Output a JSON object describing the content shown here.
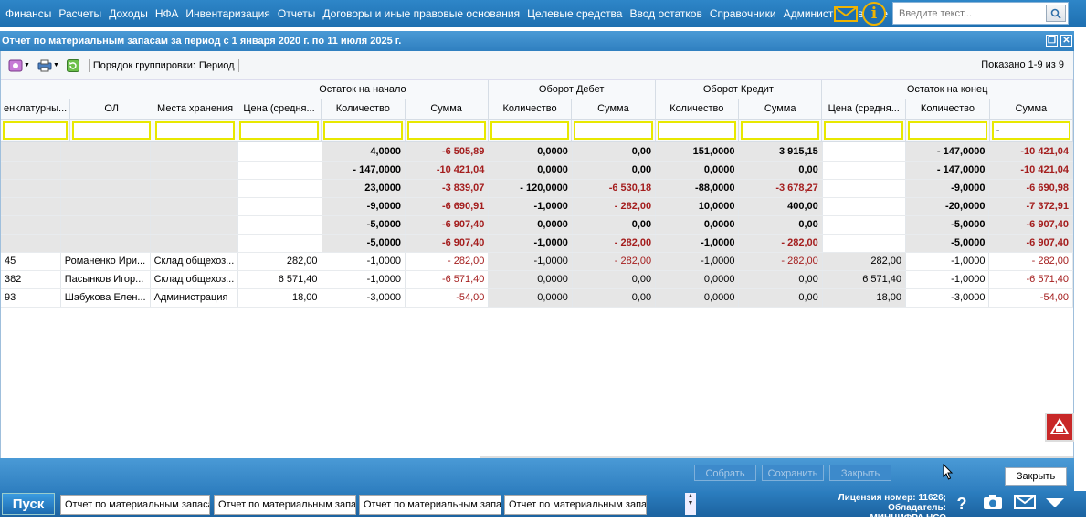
{
  "menu": [
    "Финансы",
    "Расчеты",
    "Доходы",
    "НФА",
    "Инвентаризация",
    "Отчеты",
    "Договоры и иные правовые основания",
    "Целевые средства",
    "Ввод остатков",
    "Справочники",
    "Администрирование"
  ],
  "search": {
    "placeholder": "Введите текст..."
  },
  "window": {
    "title": "Отчет по материальным запасам за период с 1 января 2020 г. по 11 июля 2025 г."
  },
  "toolbar": {
    "grouping_label": "Порядок группировки:",
    "grouping_value": "Период",
    "shown": "Показано 1-9 из 9"
  },
  "columns": {
    "group_headers": [
      "Остаток на начало",
      "Оборот Дебет",
      "Оборот Кредит",
      "Остаток на конец"
    ],
    "sub_headers": [
      "енклатурны...",
      "ОЛ",
      "Места хранения",
      "Цена (средня...",
      "Количество",
      "Сумма",
      "Количество",
      "Сумма",
      "Количество",
      "Сумма",
      "Цена (средня...",
      "Количество",
      "Сумма"
    ],
    "active_filter_value": "-"
  },
  "rows": [
    {
      "type": "group",
      "cells": [
        "",
        "",
        "",
        "",
        "4,0000",
        "-6 505,89",
        "0,0000",
        "0,00",
        "151,0000",
        "3 915,15",
        "",
        "- 147,0000",
        "-10 421,04"
      ]
    },
    {
      "type": "group",
      "cells": [
        "",
        "",
        "",
        "",
        "- 147,0000",
        "-10 421,04",
        "0,0000",
        "0,00",
        "0,0000",
        "0,00",
        "",
        "- 147,0000",
        "-10 421,04"
      ]
    },
    {
      "type": "group",
      "cells": [
        "",
        "",
        "",
        "",
        "23,0000",
        "-3 839,07",
        "- 120,0000",
        "-6 530,18",
        "-88,0000",
        "-3 678,27",
        "",
        "-9,0000",
        "-6 690,98"
      ]
    },
    {
      "type": "group",
      "cells": [
        "",
        "",
        "",
        "",
        "-9,0000",
        "-6 690,91",
        "-1,0000",
        "- 282,00",
        "10,0000",
        "400,00",
        "",
        "-20,0000",
        "-7 372,91"
      ]
    },
    {
      "type": "group",
      "cells": [
        "",
        "",
        "",
        "",
        "-5,0000",
        "-6 907,40",
        "0,0000",
        "0,00",
        "0,0000",
        "0,00",
        "",
        "-5,0000",
        "-6 907,40"
      ]
    },
    {
      "type": "group",
      "cells": [
        "",
        "",
        "",
        "",
        "-5,0000",
        "-6 907,40",
        "-1,0000",
        "- 282,00",
        "-1,0000",
        "- 282,00",
        "",
        "-5,0000",
        "-6 907,40"
      ]
    },
    {
      "type": "detail",
      "cells": [
        "45",
        "Романенко Ири...",
        "Склад общехоз...",
        "282,00",
        "-1,0000",
        "- 282,00",
        "-1,0000",
        "- 282,00",
        "-1,0000",
        "- 282,00",
        "282,00",
        "-1,0000",
        "- 282,00"
      ]
    },
    {
      "type": "detail",
      "cells": [
        "382",
        "Пасынков Игор...",
        "Склад общехоз...",
        "6 571,40",
        "-1,0000",
        "-6 571,40",
        "0,0000",
        "0,00",
        "0,0000",
        "0,00",
        "6 571,40",
        "-1,0000",
        "-6 571,40"
      ]
    },
    {
      "type": "detail",
      "cells": [
        "93",
        "Шабукова Елен...",
        "Администрация",
        "18,00",
        "-3,0000",
        "-54,00",
        "0,0000",
        "0,00",
        "0,0000",
        "0,00",
        "18,00",
        "-3,0000",
        "-54,00"
      ]
    }
  ],
  "bottom": {
    "collect": "Собрать",
    "save": "Сохранить",
    "close_disabled": "Закрыть",
    "close": "Закрыть"
  },
  "taskbar": {
    "start": "Пуск",
    "tasks": [
      "Отчет по материальным запасам",
      "Отчет по материальным запа...",
      "Отчет по материальным запа...",
      "Отчет по материальным запа..."
    ],
    "license_line1": "Лицензия номер: 11626; Обладатель:",
    "license_line2": "МИНЦИФРА НСО"
  },
  "colors": {
    "menu_bg": "#1e6fb0",
    "negative": "#a41d1d",
    "filter_border": "#e8e800",
    "group_row_bg": "#e6e6e6"
  }
}
